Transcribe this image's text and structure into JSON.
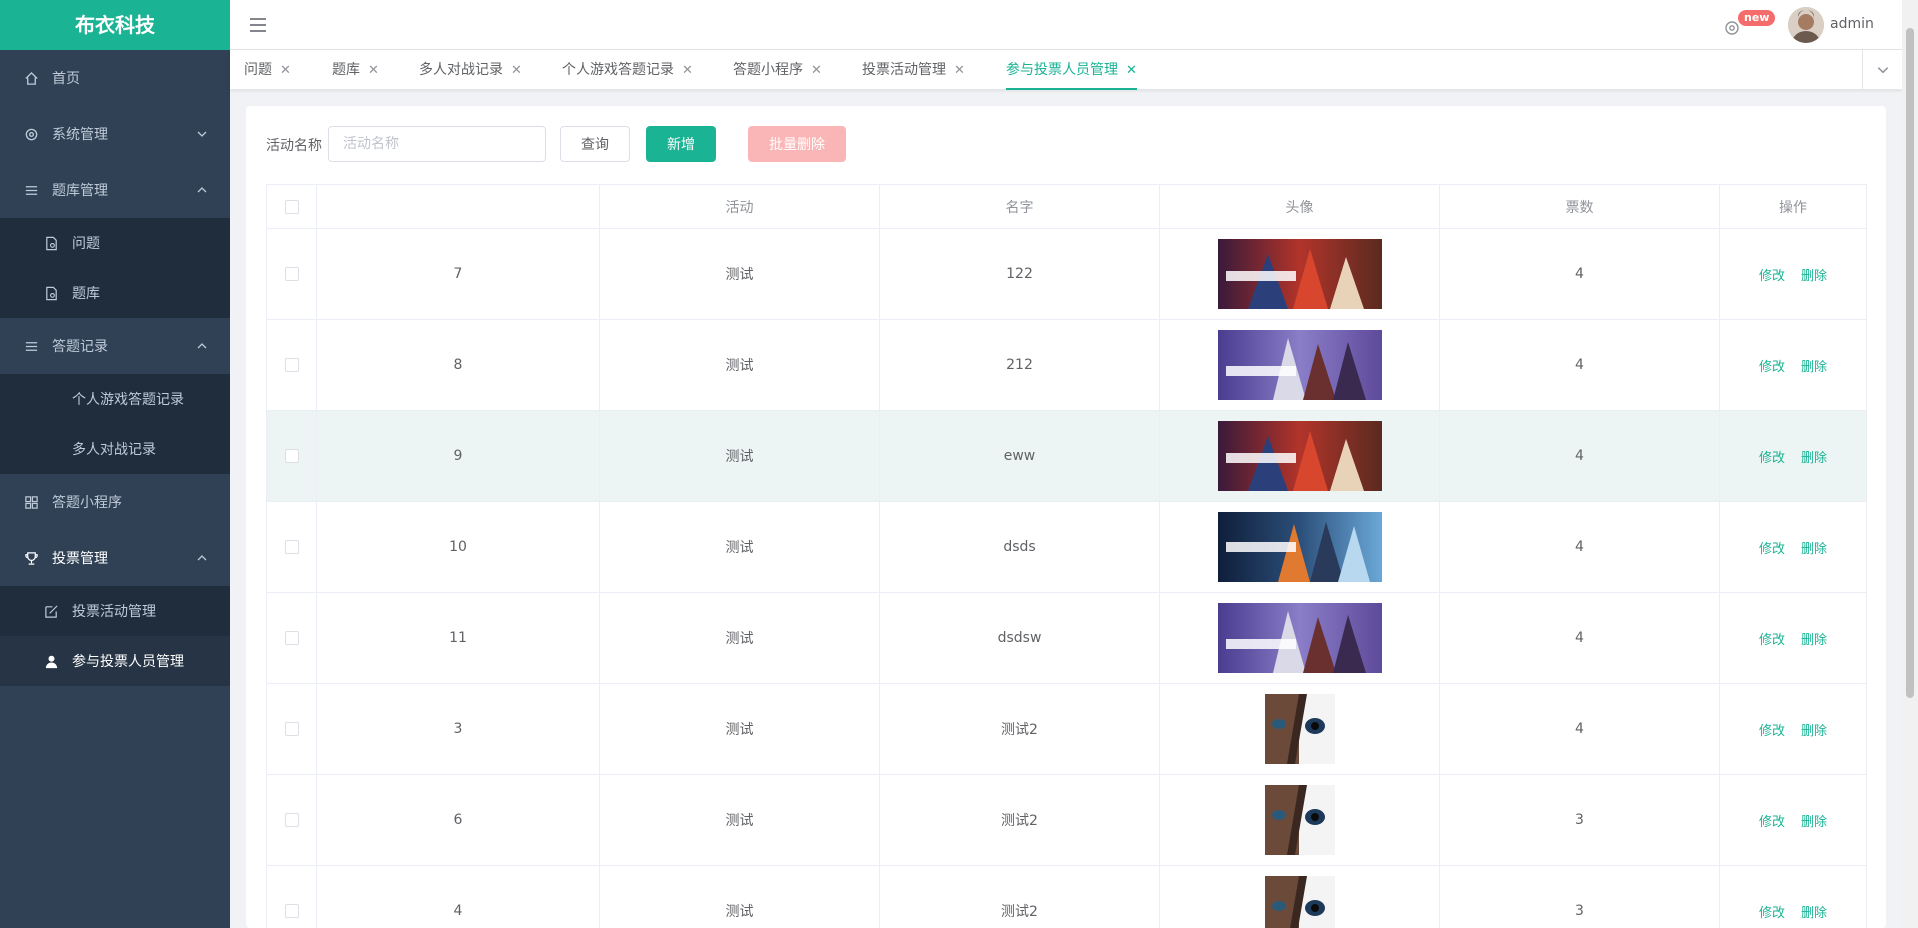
{
  "app": {
    "logo": "布衣科技"
  },
  "sidebar": {
    "items": [
      {
        "label": "首页"
      },
      {
        "label": "系统管理"
      },
      {
        "label": "题库管理",
        "children": [
          {
            "label": "问题"
          },
          {
            "label": "题库"
          }
        ]
      },
      {
        "label": "答题记录",
        "children": [
          {
            "label": "个人游戏答题记录"
          },
          {
            "label": "多人对战记录"
          }
        ]
      },
      {
        "label": "答题小程序"
      },
      {
        "label": "投票管理",
        "children": [
          {
            "label": "投票活动管理"
          },
          {
            "label": "参与投票人员管理"
          }
        ]
      }
    ]
  },
  "header": {
    "badge": "new",
    "username": "admin"
  },
  "tabs": [
    {
      "label": "问题"
    },
    {
      "label": "题库"
    },
    {
      "label": "多人对战记录"
    },
    {
      "label": "个人游戏答题记录"
    },
    {
      "label": "答题小程序"
    },
    {
      "label": "投票活动管理"
    },
    {
      "label": "参与投票人员管理",
      "active": true
    }
  ],
  "filter": {
    "label": "活动名称",
    "placeholder": "活动名称",
    "query": "查询",
    "add": "新增",
    "batch_delete": "批量删除"
  },
  "table": {
    "columns": [
      "",
      "活动",
      "名字",
      "头像",
      "票数",
      "操作"
    ],
    "actions": {
      "edit": "修改",
      "delete": "删除"
    },
    "rows": [
      {
        "id": "7",
        "activity": "测试",
        "name": "122",
        "avatar": "anime-banner-red",
        "votes": "4"
      },
      {
        "id": "8",
        "activity": "测试",
        "name": "212",
        "avatar": "anime-banner-purple",
        "votes": "4"
      },
      {
        "id": "9",
        "activity": "测试",
        "name": "eww",
        "avatar": "anime-banner-red",
        "votes": "4"
      },
      {
        "id": "10",
        "activity": "测试",
        "name": "dsds",
        "avatar": "anime-banner-blue",
        "votes": "4"
      },
      {
        "id": "11",
        "activity": "测试",
        "name": "dsdsw",
        "avatar": "anime-banner-purple",
        "votes": "4"
      },
      {
        "id": "3",
        "activity": "测试",
        "name": "测试2",
        "avatar": "face-eye",
        "votes": "4"
      },
      {
        "id": "6",
        "activity": "测试",
        "name": "测试2",
        "avatar": "face-eye",
        "votes": "3"
      },
      {
        "id": "4",
        "activity": "测试",
        "name": "测试2",
        "avatar": "face-eye",
        "votes": "3"
      }
    ]
  },
  "colors": {
    "brand": "#1ab394",
    "sidebar": "#304156",
    "danger_light": "#fab6b6"
  }
}
